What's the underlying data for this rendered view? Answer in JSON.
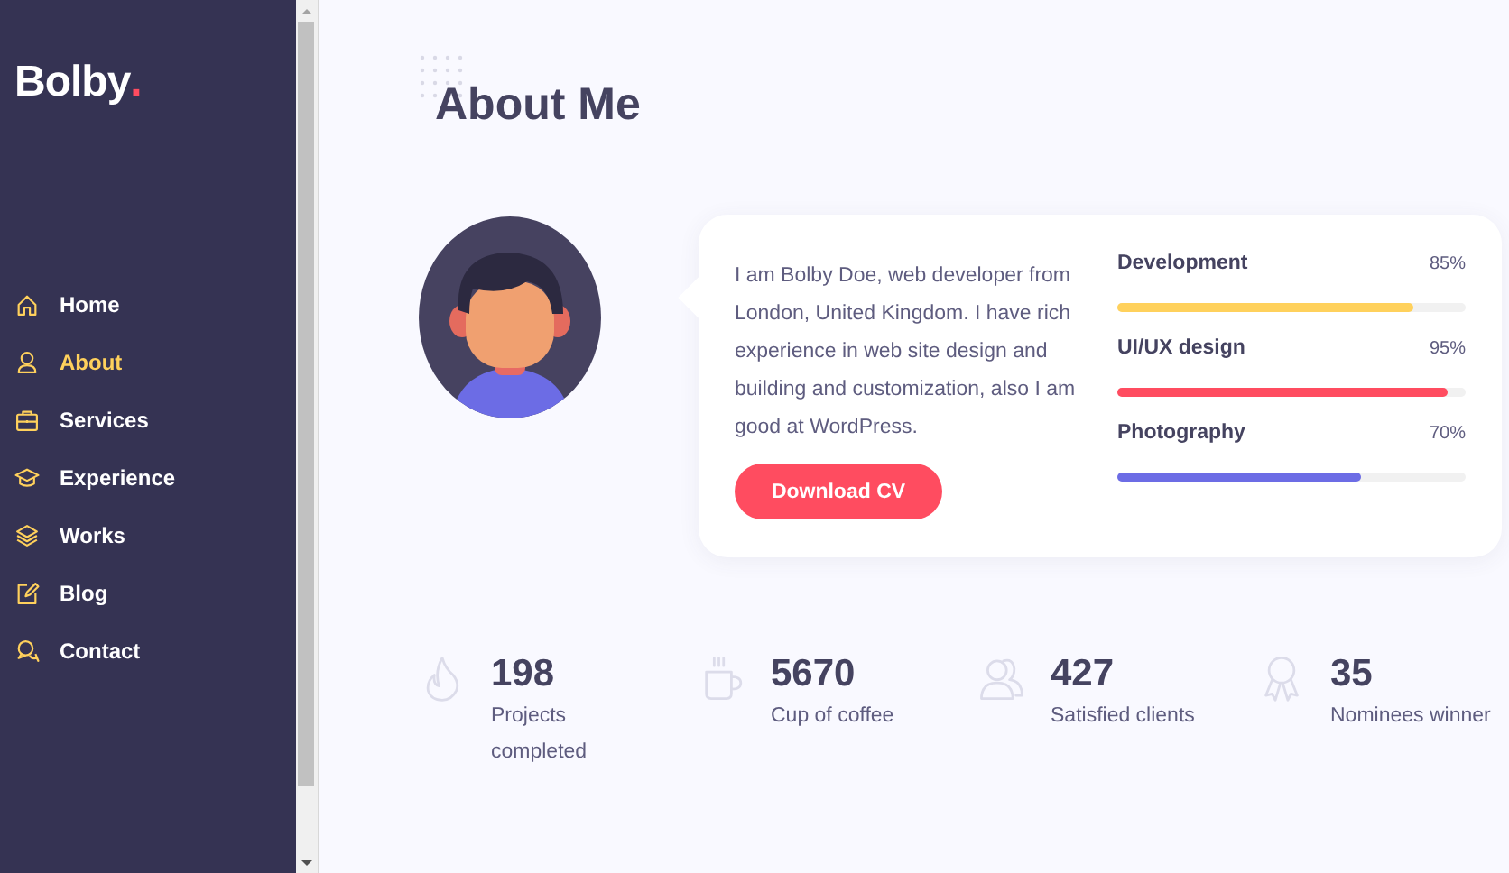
{
  "logo": {
    "text": "Bolby",
    "dot": "."
  },
  "nav": [
    {
      "label": "Home",
      "selected": false
    },
    {
      "label": "About",
      "selected": true
    },
    {
      "label": "Services",
      "selected": false
    },
    {
      "label": "Experience",
      "selected": false
    },
    {
      "label": "Works",
      "selected": false
    },
    {
      "label": "Blog",
      "selected": false
    },
    {
      "label": "Contact",
      "selected": false
    }
  ],
  "section_title": "About Me",
  "bio": "I am Bolby Doe, web developer from London, United Kingdom. I have rich experience in web site design and building and customization, also I am good at WordPress.",
  "download_button": "Download CV",
  "skills": [
    {
      "name": "Development",
      "reading": "85%",
      "level": 0.85,
      "color": "#ffd15c"
    },
    {
      "name": "UI/UX design",
      "reading": "95%",
      "level": 0.95,
      "color": "#ff4c60"
    },
    {
      "name": "Photography",
      "reading": "70%",
      "level": 0.7,
      "color": "#6c6ce5"
    }
  ],
  "stats": [
    {
      "number": "198",
      "label": "Projects completed"
    },
    {
      "number": "5670",
      "label": "Cup of coffee"
    },
    {
      "number": "427",
      "label": "Satisfied clients"
    },
    {
      "number": "35",
      "label": "Nominees winner"
    }
  ]
}
